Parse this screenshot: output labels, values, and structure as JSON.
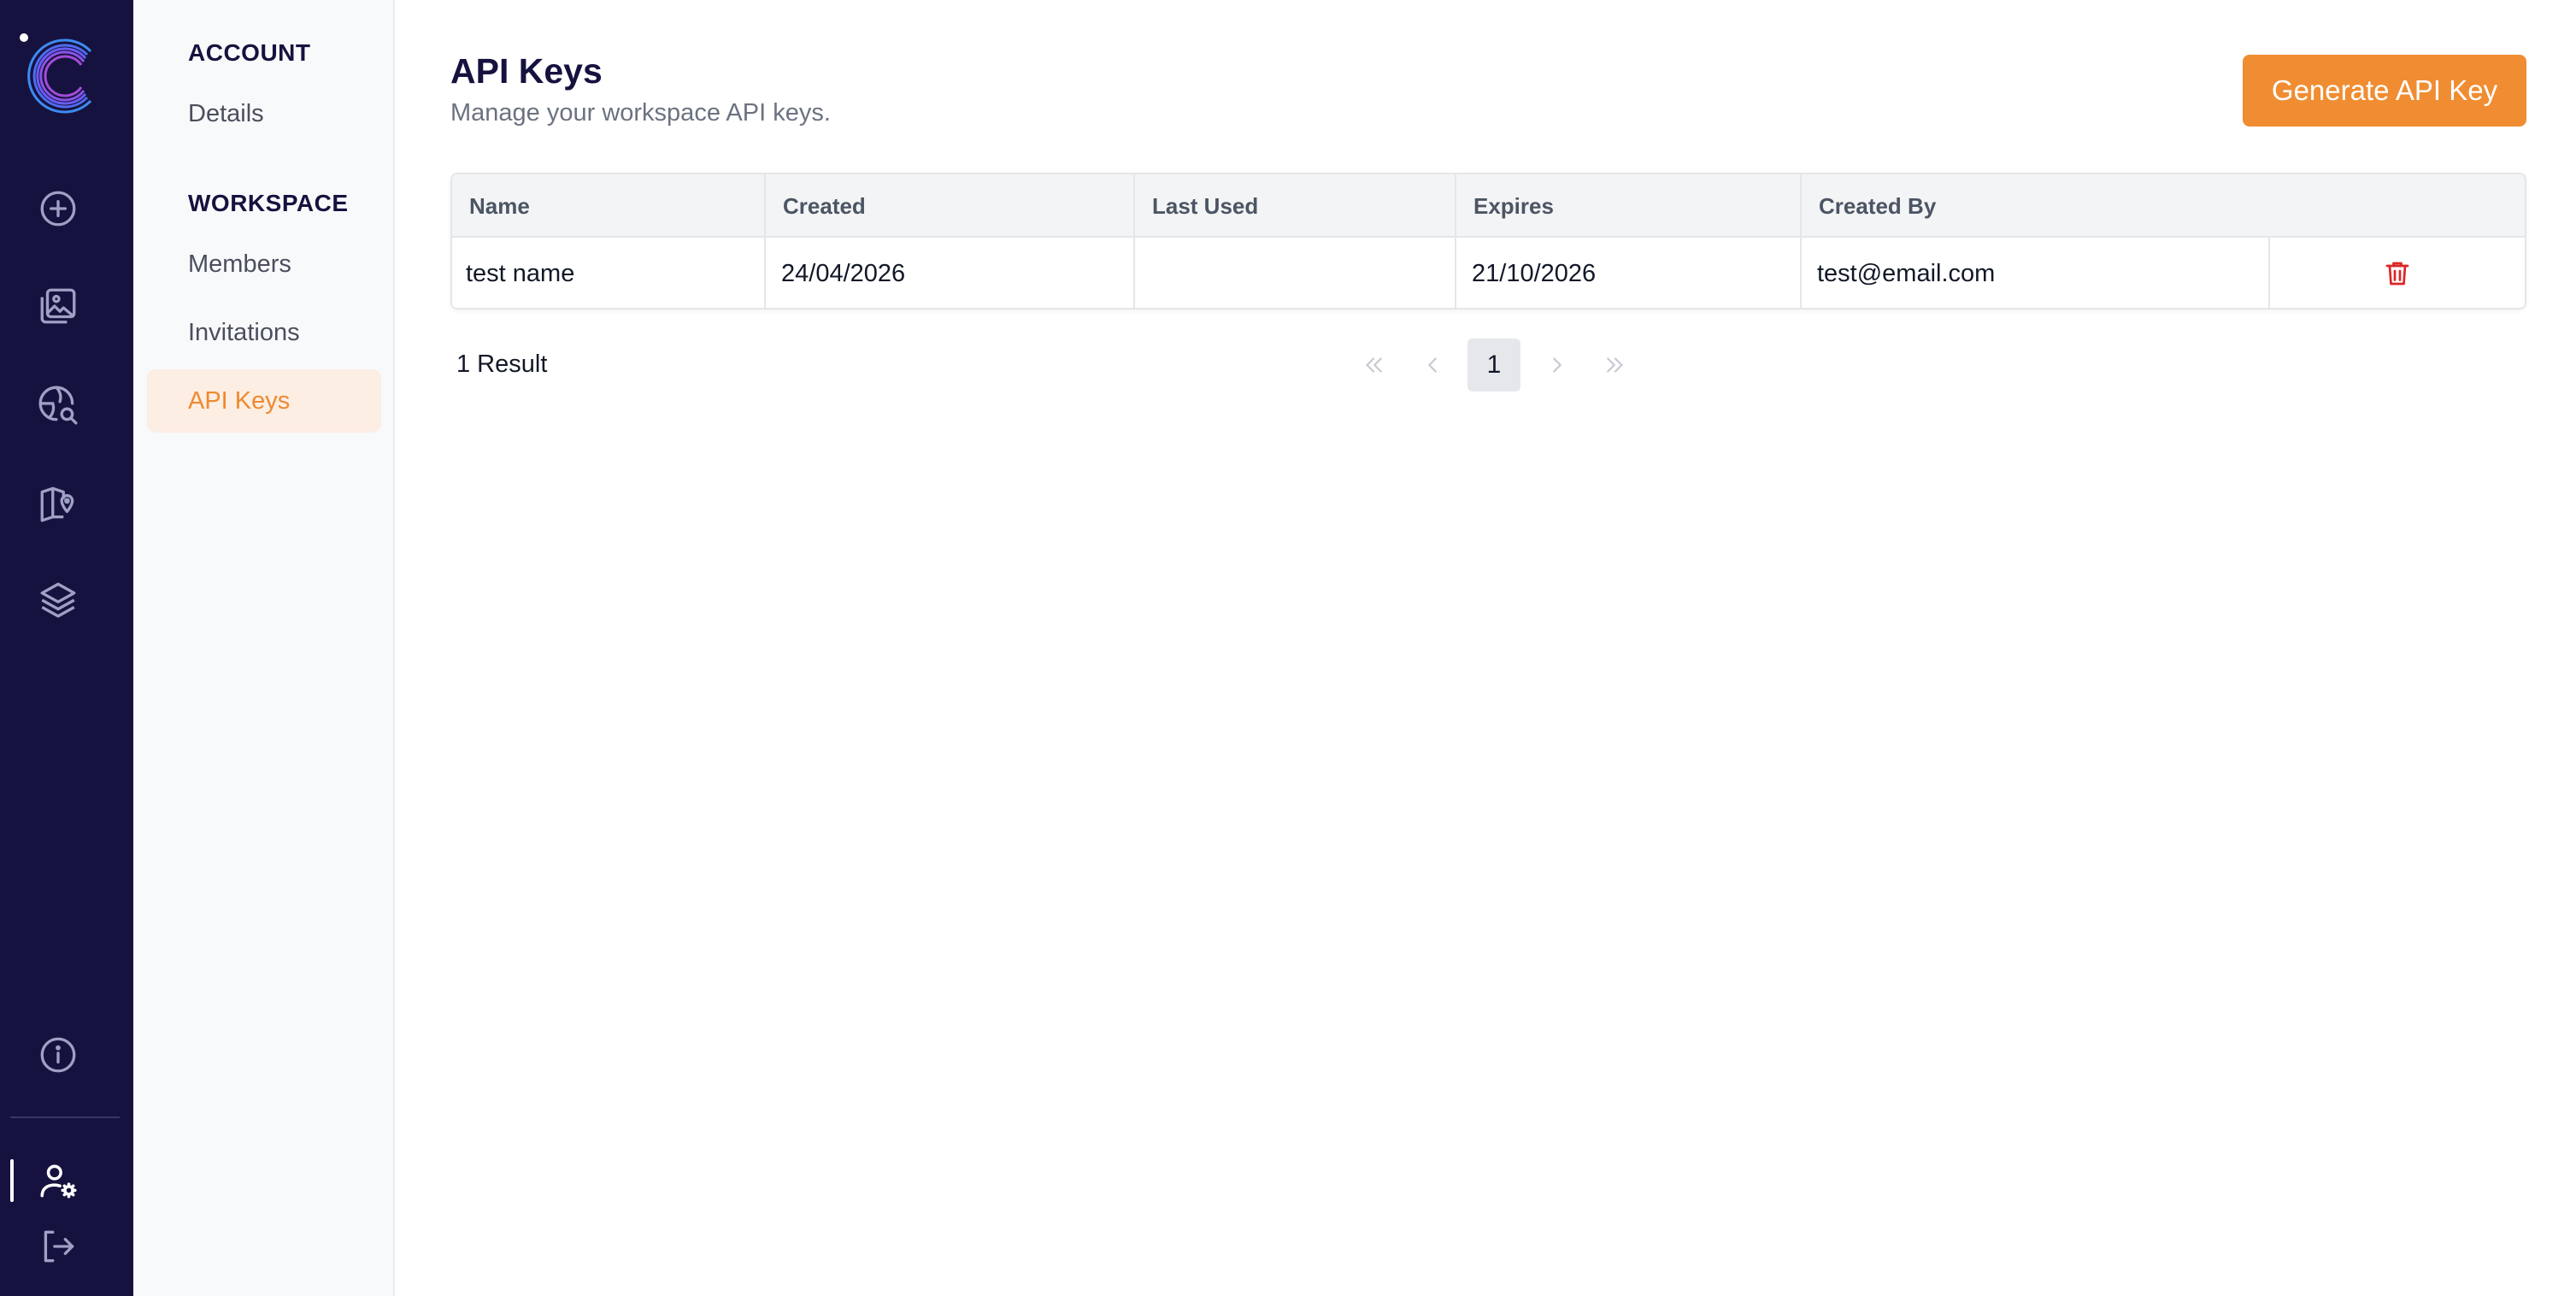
{
  "nav": {
    "sections": [
      {
        "title": "ACCOUNT",
        "items": [
          {
            "label": "Details"
          }
        ]
      },
      {
        "title": "WORKSPACE",
        "items": [
          {
            "label": "Members"
          },
          {
            "label": "Invitations"
          },
          {
            "label": "API Keys",
            "active": true
          }
        ]
      }
    ]
  },
  "rail": {
    "icons": [
      "add-icon",
      "image-gallery-icon",
      "globe-search-icon",
      "map-pin-icon",
      "layers-icon",
      "info-icon",
      "user-settings-icon",
      "logout-icon"
    ],
    "active": "user-settings-icon"
  },
  "page": {
    "title": "API Keys",
    "subtitle": "Manage your workspace API keys.",
    "generate_button": "Generate API Key"
  },
  "table": {
    "columns": [
      "Name",
      "Created",
      "Last Used",
      "Expires",
      "Created By"
    ],
    "rows": [
      {
        "name": "test name",
        "created": "24/04/2026",
        "last_used": "",
        "expires": "21/10/2026",
        "created_by": "test@email.com"
      }
    ]
  },
  "pagination": {
    "result_label": "1 Result",
    "current_page": "1"
  },
  "colors": {
    "rail_bg": "#16123f",
    "accent": "#f08d32",
    "accent_soft": "#fdeee3",
    "danger": "#dc2626"
  }
}
